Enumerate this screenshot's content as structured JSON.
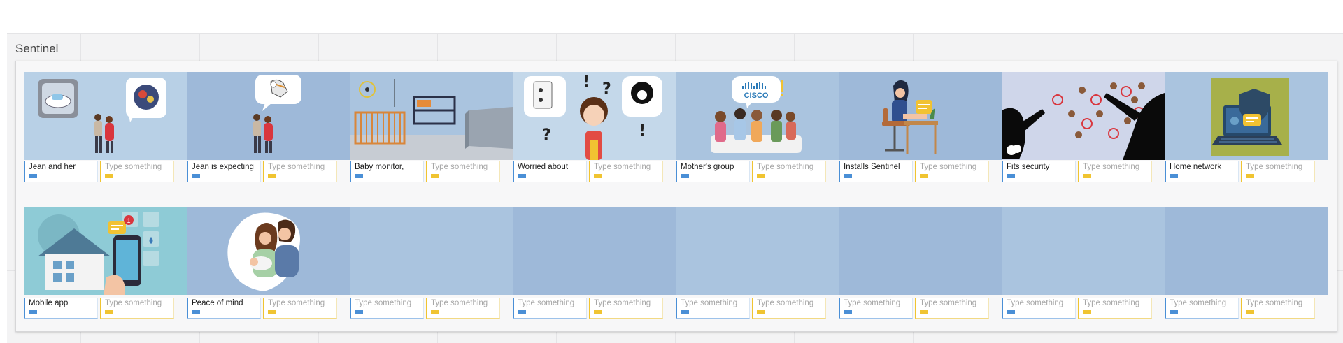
{
  "board": {
    "title": "Sentinel",
    "placeholder": "Type something"
  },
  "row1": [
    {
      "label": "Jean and her",
      "icon": "couple-car-bubble"
    },
    {
      "label": "Jean is expecting",
      "icon": "stork-couple"
    },
    {
      "label": "Baby monitor,",
      "icon": "nursery-room"
    },
    {
      "label": "Worried about",
      "icon": "worried-woman-hacker"
    },
    {
      "label": "Mother's group",
      "icon": "mothers-group-cisco"
    },
    {
      "label": "Installs Sentinel",
      "icon": "woman-at-desk"
    },
    {
      "label": "Fits security",
      "icon": "network-security-silhouettes"
    },
    {
      "label": "Home network",
      "icon": "laptop-shield"
    }
  ],
  "row2": [
    {
      "label": "Mobile app",
      "icon": "smart-home-phone"
    },
    {
      "label": "Peace of mind",
      "icon": "family-baby"
    },
    {
      "label": "",
      "icon": ""
    },
    {
      "label": "",
      "icon": ""
    },
    {
      "label": "",
      "icon": ""
    },
    {
      "label": "",
      "icon": ""
    },
    {
      "label": "",
      "icon": ""
    },
    {
      "label": "",
      "icon": ""
    }
  ],
  "scene_text": {
    "cisco": "CISCO",
    "notification_count": "1"
  }
}
